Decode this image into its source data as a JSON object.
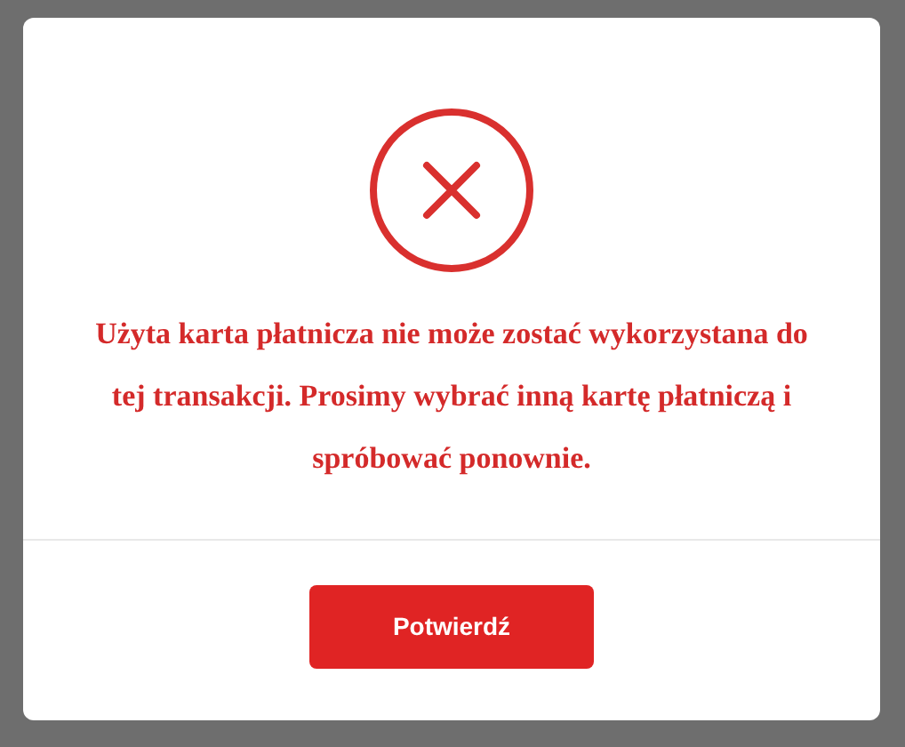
{
  "dialog": {
    "message": "Użyta karta płatnicza nie może zostać wykorzystana do tej transakcji. Prosimy wybrać inną kartę płatniczą i spróbować ponownie.",
    "button": "Potwierdź"
  }
}
